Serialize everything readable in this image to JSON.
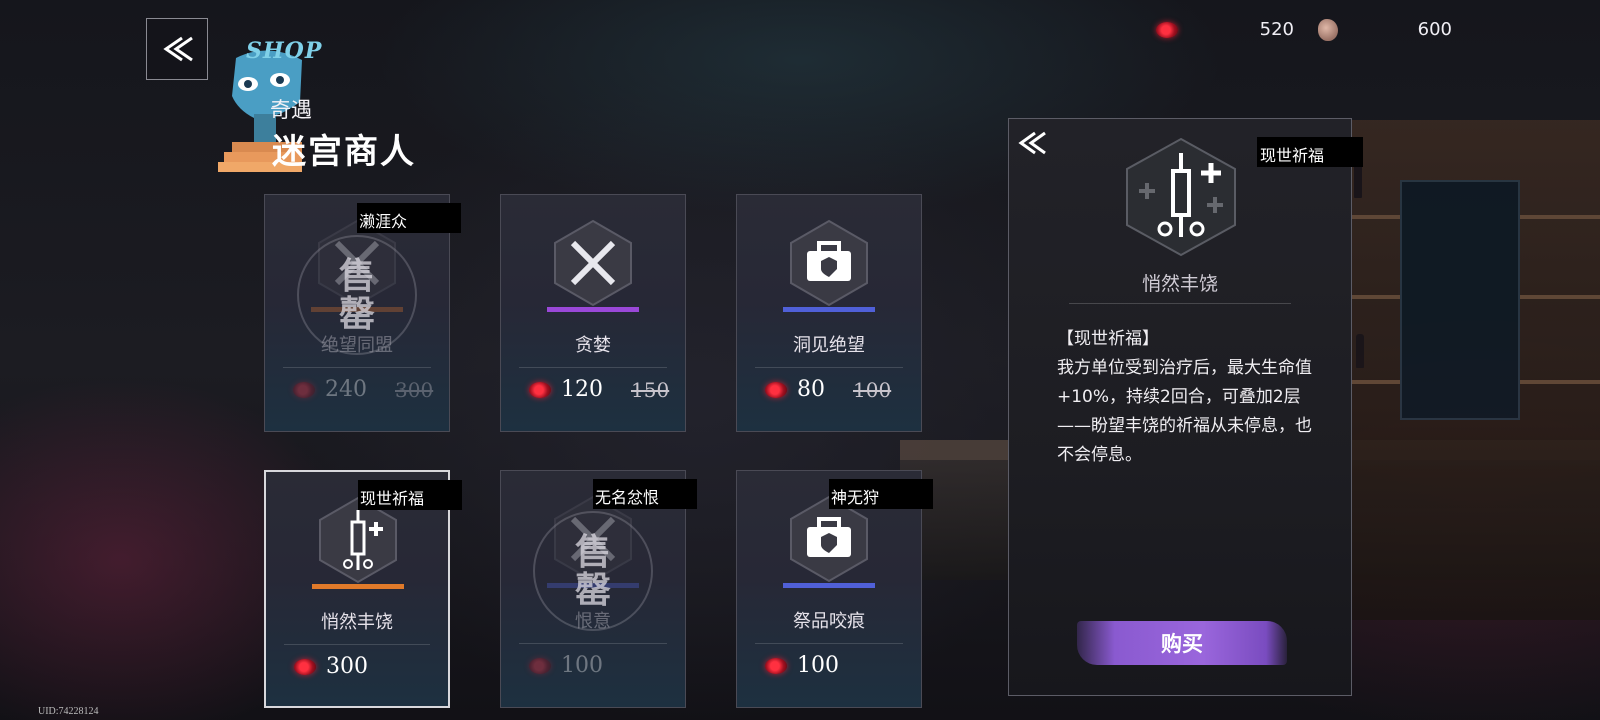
{
  "header": {
    "shop_logo_text": "SHOP",
    "subtitle": "奇遇",
    "title": "迷宫商人"
  },
  "currencies": [
    {
      "icon": "blood-drop-icon",
      "amount": "520"
    },
    {
      "icon": "bean-icon",
      "amount": "600"
    }
  ],
  "cards": [
    {
      "tag": "濑涯众",
      "name": "绝望同盟",
      "price": "240",
      "old_price": "300",
      "rarity_color": "#d07030",
      "icon": "crossed-blades-icon",
      "sold": true
    },
    {
      "tag": "",
      "name": "贪婪",
      "price": "120",
      "old_price": "150",
      "rarity_color": "#9a48d8",
      "icon": "crossed-blades-icon",
      "sold": false
    },
    {
      "tag": "",
      "name": "洞见绝望",
      "price": "80",
      "old_price": "100",
      "rarity_color": "#5060d8",
      "icon": "toolbox-icon",
      "sold": false
    },
    {
      "tag": "现世祈福",
      "name": "悄然丰饶",
      "price": "300",
      "old_price": "",
      "rarity_color": "#e07a2a",
      "icon": "syringe-icon",
      "sold": false
    },
    {
      "tag": "无名忿恨",
      "name": "恨意",
      "price": "100",
      "old_price": "",
      "rarity_color": "#5060d8",
      "icon": "crossed-blades-icon",
      "sold": true
    },
    {
      "tag": "神无狩",
      "name": "祭品咬痕",
      "price": "100",
      "old_price": "",
      "rarity_color": "#5060d8",
      "icon": "toolbox-icon",
      "sold": false
    }
  ],
  "sold_stamp": {
    "line1": "售",
    "line2": "罄"
  },
  "detail": {
    "tag": "现世祈福",
    "name": "悄然丰饶",
    "desc_title": "【现世祈福】",
    "desc_body": "我方单位受到治疗后，最大生命值+10%，持续2回合，可叠加2层",
    "desc_flavor": "——盼望丰饶的祈福从未停息，也不会停息。",
    "buy_label": "购买"
  },
  "uid": "UID:74228124"
}
